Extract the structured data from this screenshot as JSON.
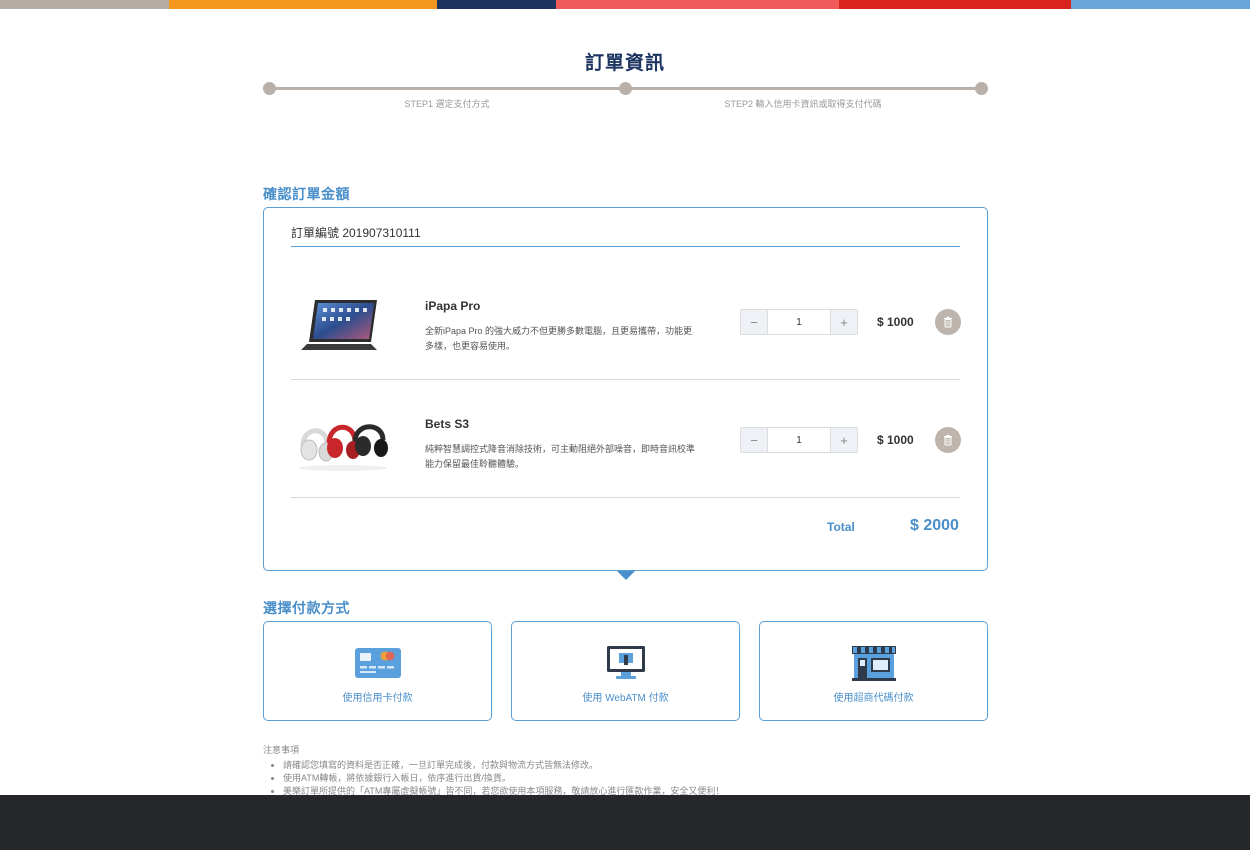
{
  "colors": {
    "stripe": [
      "#b3aba4",
      "#f5961e",
      "#1d3461",
      "#f05a5b",
      "#d9231f",
      "#6aa6d8"
    ],
    "accent": "#4a8fca",
    "title": "#1d3461",
    "step": "#b8b0a9",
    "footer": "#26272b"
  },
  "header": {
    "title": "訂單資訊"
  },
  "steps": [
    {
      "label": "STEP1 選定支付方式"
    },
    {
      "label": "STEP2 輸入信用卡資訊或取得支付代碼"
    }
  ],
  "order": {
    "section_title": "確認訂單金額",
    "order_number": "訂單編號 201907310111",
    "items": [
      {
        "name": "iPapa Pro",
        "description": "全新iPapa Pro 的強大威力不但更勝多數電腦，且更易攜帶，功能更多樣，也更容易使用。",
        "quantity": "1",
        "price": "$ 1000",
        "image_icon": "tablet-keyboard-image"
      },
      {
        "name": "Bets S3",
        "description": "純粹智慧調控式降音消除技術，可主動阻絕外部噪音，即時音訊校準能力保留最佳聆聽體驗。",
        "quantity": "1",
        "price": "$ 1000",
        "image_icon": "headphones-image"
      }
    ],
    "total_label": "Total",
    "total_value": "$ 2000",
    "minus": "−",
    "plus": "+"
  },
  "payment": {
    "section_title": "選擇付款方式",
    "methods": [
      {
        "label": "使用信用卡付款",
        "icon": "credit-card-icon"
      },
      {
        "label": "使用 WebATM 付款",
        "icon": "monitor-icon"
      },
      {
        "label": "使用超商代碼付款",
        "icon": "convenience-store-icon"
      }
    ]
  },
  "notes": {
    "title": "注意事項",
    "items": [
      "請確認您填寫的資料是否正確，一旦訂單完成後，付款與物流方式皆無法修改。",
      "使用ATM轉帳，將依據銀行入帳日，依序進行出貨/換貨。",
      "美樂訂單所提供的「ATM專屬虛擬帳號」皆不同，若您欲使用本項服務，敬請放心進行匯款作業，安全又便利！"
    ]
  }
}
